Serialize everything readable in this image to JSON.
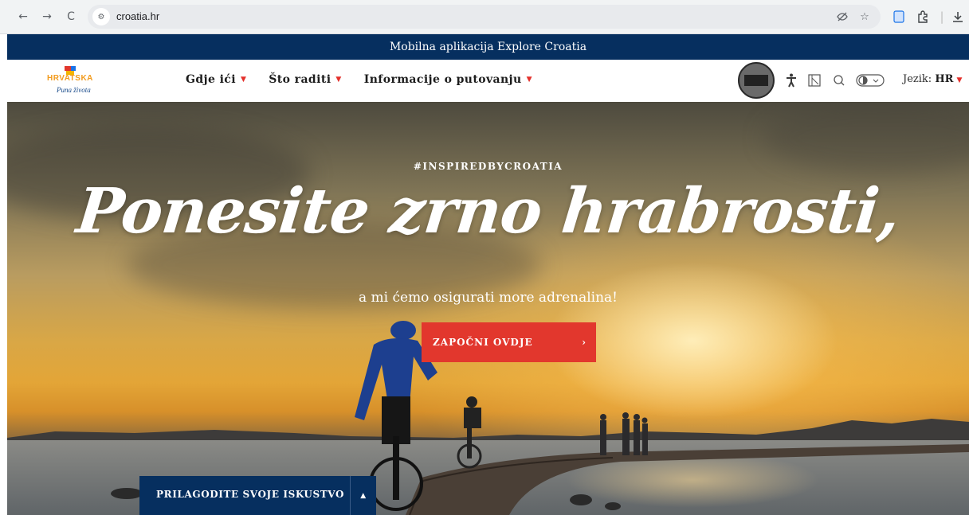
{
  "browser": {
    "url": "croatia.hr",
    "back_icon": "←",
    "forward_icon": "→",
    "reload_icon": "C",
    "site_info_icon": "⚙"
  },
  "banner": {
    "text": "Mobilna aplikacija Explore Croatia"
  },
  "header": {
    "logo_text": "HRVATSKA",
    "logo_sub": "Puna života",
    "nav": [
      {
        "label": "Gdje ići"
      },
      {
        "label": "Što raditi"
      },
      {
        "label": "Informacije o putovanju"
      }
    ],
    "language_label": "Jezik:",
    "language_value": "HR"
  },
  "hero": {
    "hashtag": "#INSPIREDBYCROATIA",
    "headline": "Ponesite zrno hrabrosti,",
    "subline": "a mi ćemo osigurati more adrenalina!",
    "cta_label": "ZAPOČNI OVDJE",
    "customize_label": "PRILAGODITE SVOJE ISKUSTVO"
  },
  "colors": {
    "navy": "#062f5f",
    "accent_red": "#e2372d"
  }
}
